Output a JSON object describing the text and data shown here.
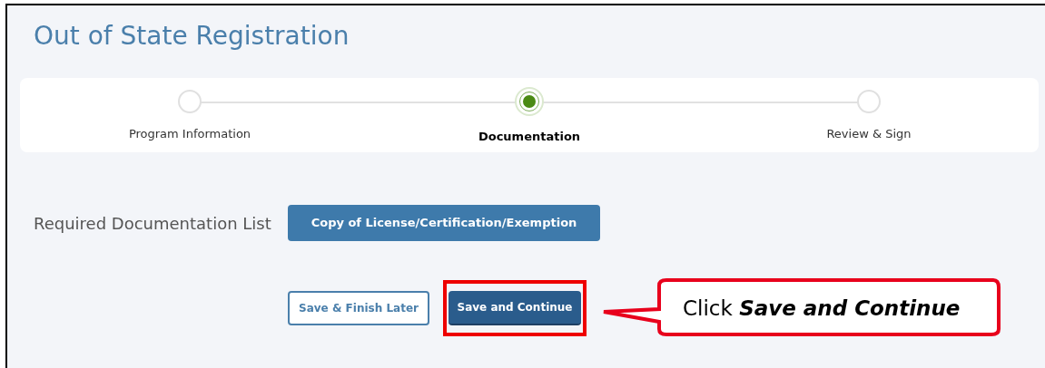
{
  "page": {
    "title": "Out of State Registration"
  },
  "steps": [
    {
      "label": "Program Information",
      "selected": false
    },
    {
      "label": "Documentation",
      "selected": true
    },
    {
      "label": "Review & Sign",
      "selected": false
    }
  ],
  "documentation": {
    "label": "Required Documentation List",
    "items": [
      "Copy of License/Certification/Exemption"
    ]
  },
  "buttons": [
    {
      "label": "Save & Finish Later",
      "kind": "secondary",
      "highlighted": false
    },
    {
      "label": "Save and Continue",
      "kind": "primary",
      "highlighted": true
    }
  ],
  "callout": {
    "text": "Click **Save and Continue**"
  }
}
